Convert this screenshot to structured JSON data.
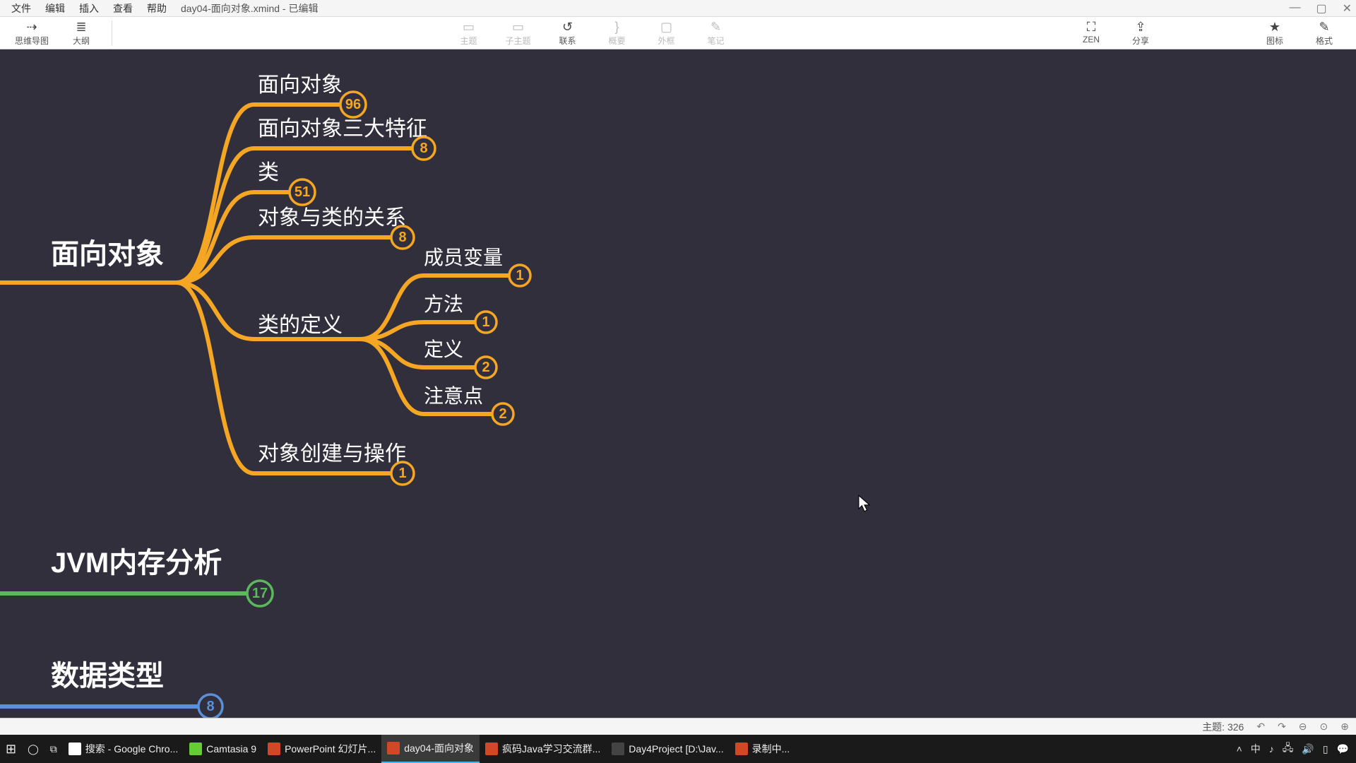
{
  "window": {
    "title": "day04-面向对象.xmind - 已编辑",
    "menus": [
      "文件",
      "编辑",
      "插入",
      "查看",
      "帮助"
    ]
  },
  "toolbar": {
    "left": [
      {
        "name": "mindmap-view",
        "icon": "⇢",
        "label": "思维导图",
        "disabled": false
      },
      {
        "name": "outline-view",
        "icon": "≣",
        "label": "大纲",
        "disabled": false
      }
    ],
    "center": [
      {
        "name": "topic",
        "icon": "▭",
        "label": "主题",
        "disabled": true
      },
      {
        "name": "subtopic",
        "icon": "▭",
        "label": "子主题",
        "disabled": true
      },
      {
        "name": "relation",
        "icon": "↺",
        "label": "联系",
        "disabled": false
      },
      {
        "name": "summary",
        "icon": "}",
        "label": "概要",
        "disabled": true
      },
      {
        "name": "boundary",
        "icon": "▢",
        "label": "外框",
        "disabled": true
      },
      {
        "name": "note",
        "icon": "✎",
        "label": "笔记",
        "disabled": true
      }
    ],
    "right1": [
      {
        "name": "zen",
        "icon": "⛶",
        "label": "ZEN"
      },
      {
        "name": "share",
        "icon": "⇪",
        "label": "分享"
      }
    ],
    "right2": [
      {
        "name": "marker",
        "icon": "★",
        "label": "图标"
      },
      {
        "name": "format",
        "icon": "✎",
        "label": "格式"
      }
    ]
  },
  "chart_data": {
    "type": "mindmap",
    "colors": {
      "orange": "#F5A623",
      "green": "#5CB85C",
      "blue": "#5B8FD8"
    },
    "branches": [
      {
        "root": "面向对象",
        "color": "orange",
        "children": [
          {
            "label": "面向对象",
            "badge": 96
          },
          {
            "label": "面向对象三大特征",
            "badge": 8
          },
          {
            "label": "类",
            "badge": 51
          },
          {
            "label": "对象与类的关系",
            "badge": 8
          },
          {
            "label": "类的定义",
            "badge": null,
            "children": [
              {
                "label": "成员变量",
                "badge": 1
              },
              {
                "label": "方法",
                "badge": 1
              },
              {
                "label": "定义",
                "badge": 2
              },
              {
                "label": "注意点",
                "badge": 2
              }
            ]
          },
          {
            "label": "对象创建与操作",
            "badge": 1
          }
        ]
      },
      {
        "root": "JVM内存分析",
        "color": "green",
        "badge": 17
      },
      {
        "root": "数据类型",
        "color": "blue",
        "badge": 8
      }
    ]
  },
  "statusbar": {
    "topic_label": "主题:",
    "topic_count": "326"
  },
  "taskbar": {
    "items": [
      {
        "name": "chrome",
        "label": "搜索 - Google Chro...",
        "color": "#fff"
      },
      {
        "name": "camtasia",
        "label": "Camtasia 9",
        "color": "#6c3"
      },
      {
        "name": "ppt",
        "label": "PowerPoint 幻灯片...",
        "color": "#d24726"
      },
      {
        "name": "xmind",
        "label": "day04-面向对象",
        "color": "#d24726",
        "active": true
      },
      {
        "name": "qq1",
        "label": "疯码Java学习交流群...",
        "color": "#d24726"
      },
      {
        "name": "idea",
        "label": "Day4Project [D:\\Jav...",
        "color": "#444"
      },
      {
        "name": "rec",
        "label": "录制中...",
        "color": "#d24726"
      }
    ]
  }
}
